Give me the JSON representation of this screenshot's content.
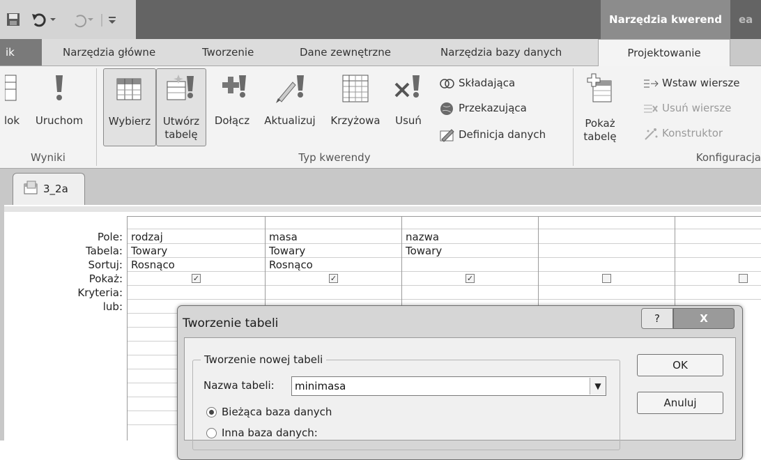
{
  "title_bar": {
    "context_title": "Narzędzia kwerend",
    "title_rest": "ea"
  },
  "tabs": {
    "file": "ik",
    "items": [
      "Narzędzia główne",
      "Tworzenie",
      "Dane zewnętrzne",
      "Narzędzia bazy danych"
    ],
    "active": "Projektowanie"
  },
  "ribbon": {
    "results": {
      "label": "Wyniki",
      "view": "lok",
      "run": "Uruchom"
    },
    "query_type": {
      "label": "Typ kwerendy",
      "select": "Wybierz",
      "make_table": "Utwórz\ntabelę",
      "append": "Dołącz",
      "update": "Aktualizuj",
      "crosstab": "Krzyżowa",
      "delete": "Usuń",
      "union": "Składająca",
      "pass_through": "Przekazująca",
      "data_definition": "Definicja danych"
    },
    "setup": {
      "label": "Konfiguracja",
      "show_table": "Pokaż\ntabelę",
      "insert_rows": "Wstaw wiersze",
      "delete_rows": "Usuń wiersze",
      "builder": "Konstruktor"
    }
  },
  "document_tab": {
    "label": "3_2a"
  },
  "grid": {
    "row_labels": [
      "Pole:",
      "Tabela:",
      "Sortuj:",
      "Pokaż:",
      "Kryteria:",
      "lub:"
    ],
    "columns": [
      {
        "field": "rodzaj",
        "table": "Towary",
        "sort": "Rosnąco",
        "show": true
      },
      {
        "field": "masa",
        "table": "Towary",
        "sort": "Rosnąco",
        "show": true
      },
      {
        "field": "nazwa",
        "table": "Towary",
        "sort": "",
        "show": true
      },
      {
        "field": "",
        "table": "",
        "sort": "",
        "show": false
      },
      {
        "field": "",
        "table": "",
        "sort": "",
        "show": false
      }
    ]
  },
  "dialog": {
    "title": "Tworzenie tabeli",
    "help": "?",
    "close": "X",
    "group_title": "Tworzenie nowej tabeli",
    "name_label": "Nazwa tabeli:",
    "name_value": "minimasa",
    "option_current": "Bieżąca baza danych",
    "option_other": "Inna baza danych:",
    "ok": "OK",
    "cancel": "Anuluj"
  }
}
